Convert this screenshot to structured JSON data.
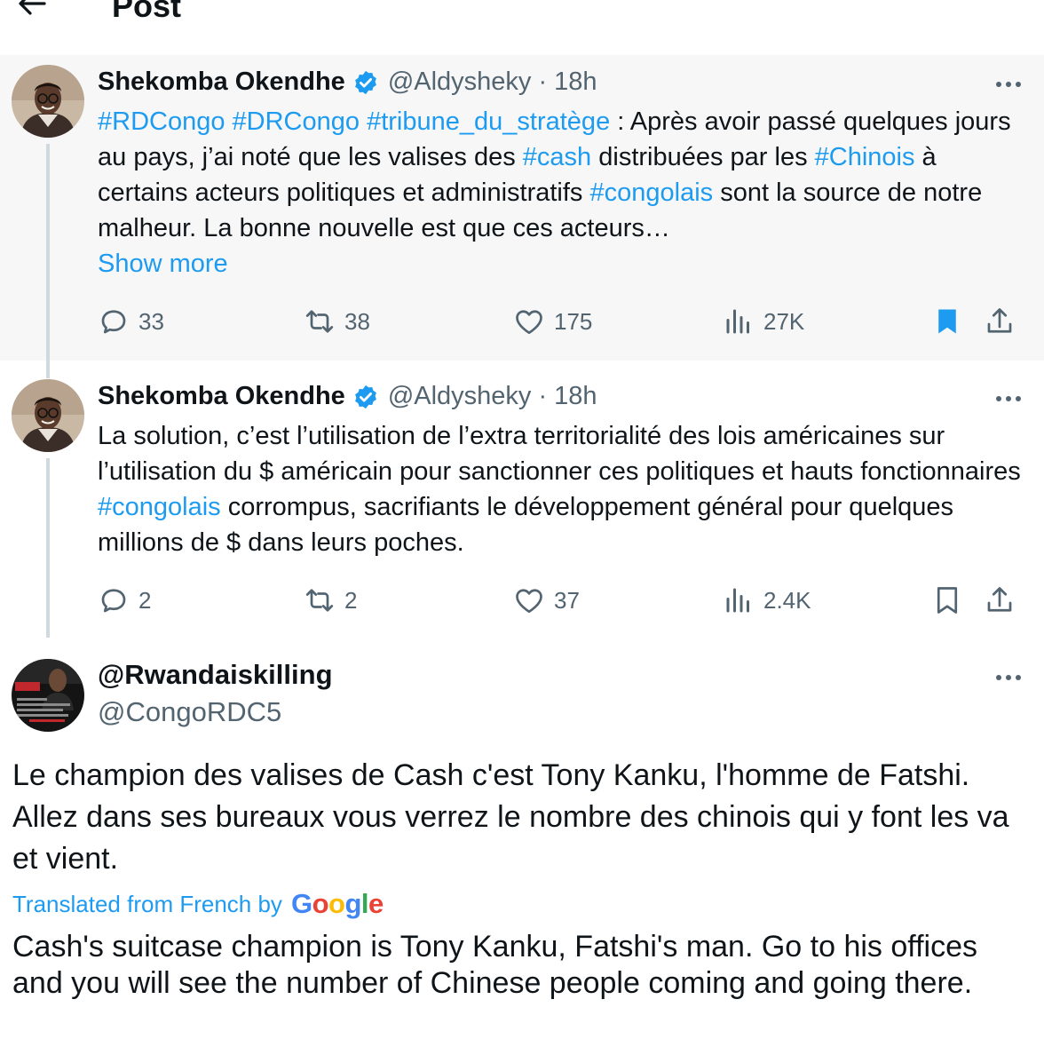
{
  "header": {
    "title": "Post"
  },
  "parent_tweet": {
    "name": "Shekomba Okendhe",
    "handle": "@Aldysheky",
    "separator": "·",
    "time": "18h",
    "text": {
      "tag1": "#RDCongo",
      "tag2": "#DRCongo",
      "tag3": "#tribune_du_stratège",
      "p1": " : Après avoir passé quelques jours au pays, j’ai noté que les valises des ",
      "tag4": "#cash",
      "p2": " distribuées par les ",
      "tag5": "#Chinois",
      "p3": "  à certains acteurs politiques et administratifs ",
      "tag6": "#congolais",
      "p4": " sont la source de notre malheur. La bonne nouvelle est que ces acteurs…"
    },
    "show_more": "Show more",
    "stats": {
      "replies": "33",
      "reposts": "38",
      "likes": "175",
      "views": "27K"
    },
    "bookmarked": true
  },
  "reply1": {
    "name": "Shekomba Okendhe",
    "handle": "@Aldysheky",
    "separator": "·",
    "time": "18h",
    "text": {
      "p1": "La solution, c’est l’utilisation de l’extra territorialité des lois américaines sur l’utilisation du $ américain pour sanctionner ces politiques et hauts fonctionnaires ",
      "tag1": "#congolais",
      "p2": " corrompus, sacrifiants le développement général pour quelques millions de $ dans leurs poches."
    },
    "stats": {
      "replies": "2",
      "reposts": "2",
      "likes": "37",
      "views": "2.4K"
    },
    "bookmarked": false
  },
  "reply2": {
    "name": "@Rwandaiskilling",
    "handle": "@CongoRDC5",
    "original_text": "Le champion des valises de Cash c'est Tony Kanku, l'homme de Fatshi. Allez dans ses bureaux vous verrez le nombre des chinois qui y font les va et vient.",
    "translated_label": "Translated from French by",
    "translation_provider": "Google",
    "translated_text": "Cash's suitcase champion is Tony Kanku, Fatshi's man. Go to his offices and you will see the number of Chinese people coming and going there."
  },
  "colors": {
    "accent": "#1d9bf0",
    "secondary_text": "#536471",
    "highlight_bg": "#f7f7f7"
  },
  "icons": [
    "back-arrow-icon",
    "verified-badge-icon",
    "more-icon",
    "reply-icon",
    "repost-icon",
    "like-icon",
    "views-icon",
    "bookmark-icon",
    "share-icon"
  ]
}
